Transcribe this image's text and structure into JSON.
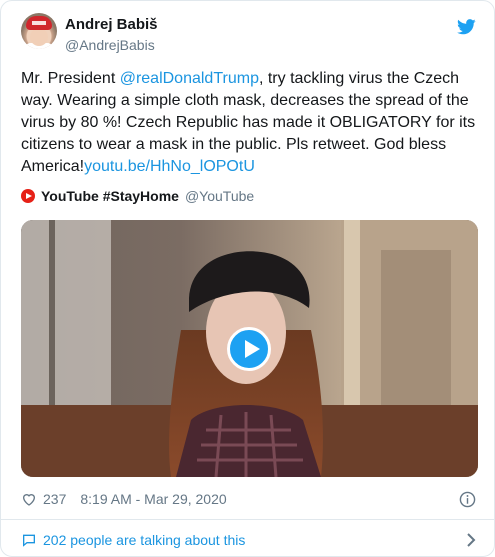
{
  "author": {
    "name": "Andrej Babiš",
    "handle": "@AndrejBabis"
  },
  "tweet": {
    "text_prefix": "Mr. President ",
    "mention": "@realDonaldTrump",
    "text_body": ", try tackling virus the Czech way. Wearing a simple cloth mask, decreases the spread of the virus by 80 %! Czech Republic has made it OBLIGATORY for its citizens to wear a mask in the public. Pls retweet. God bless America!",
    "link": "youtu.be/HhNo_lOPOtU"
  },
  "source": {
    "name": "YouTube #StayHome",
    "handle": "@YouTube"
  },
  "meta": {
    "likes": "237",
    "timestamp": "8:19 AM - Mar 29, 2020"
  },
  "discussion": {
    "label": "202 people are talking about this"
  },
  "colors": {
    "link": "#1b95e0",
    "twitter_blue": "#1da1f2",
    "youtube_red": "#e62117",
    "muted": "#657786"
  },
  "icons": [
    "twitter-bird-icon",
    "youtube-icon",
    "play-icon",
    "heart-icon",
    "info-icon",
    "comment-icon",
    "chevron-right-icon"
  ]
}
